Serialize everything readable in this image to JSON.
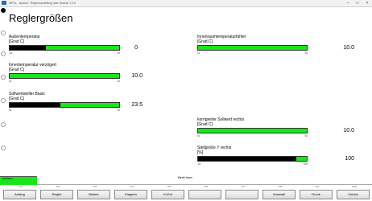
{
  "window": {
    "title": "WPCL - Audimi - Reglerdarstellung aller Module 1.0.0"
  },
  "page": {
    "title": "Reglergrößen"
  },
  "sensors": [
    {
      "name": "Außentemperatur",
      "unit": "[Grad C]",
      "value": "0",
      "min": "-20",
      "max": "40",
      "level": 0.33,
      "style": "black"
    },
    {
      "name": "Innentemperatur verzögert",
      "unit": "[Grad C]",
      "value": "10.0",
      "min": "10",
      "max": "30",
      "level": 1.0,
      "style": "green"
    },
    {
      "name": "Sollwertsteller Basis",
      "unit": "[Grad C]",
      "value": "23.5",
      "min": "18",
      "max": "30",
      "level": 0.46,
      "style": "black"
    },
    {
      "name": "Innenraumtemperaturfühler",
      "unit": "[Grad C]",
      "value": "10.0",
      "min": "10",
      "max": "30",
      "level": 1.0,
      "style": "green"
    },
    {
      "name": "korrigierter Sollwert rechts",
      "unit": "[Grad C]",
      "value": "10.0",
      "min": "10",
      "max": "30",
      "level": 1.0,
      "style": "green"
    },
    {
      "name": "Stellgröße Y rechts",
      "unit": "[%]",
      "value": "100",
      "min": "-20",
      "max": "100",
      "level": 0.9,
      "style": "black"
    }
  ],
  "status": {
    "left": "Installation",
    "center": "Werte lesen"
  },
  "fkey_labels": [
    "F1",
    "F2",
    "F3",
    "F4",
    "F5",
    "F6",
    "F7",
    "F8",
    "F9",
    "F10"
  ],
  "fkeys": [
    "Anfang",
    "Regler",
    "Bedien",
    "Klappen",
    "Kr.Ext",
    "",
    "",
    "Auswahl",
    "Druck",
    "Zurück"
  ]
}
